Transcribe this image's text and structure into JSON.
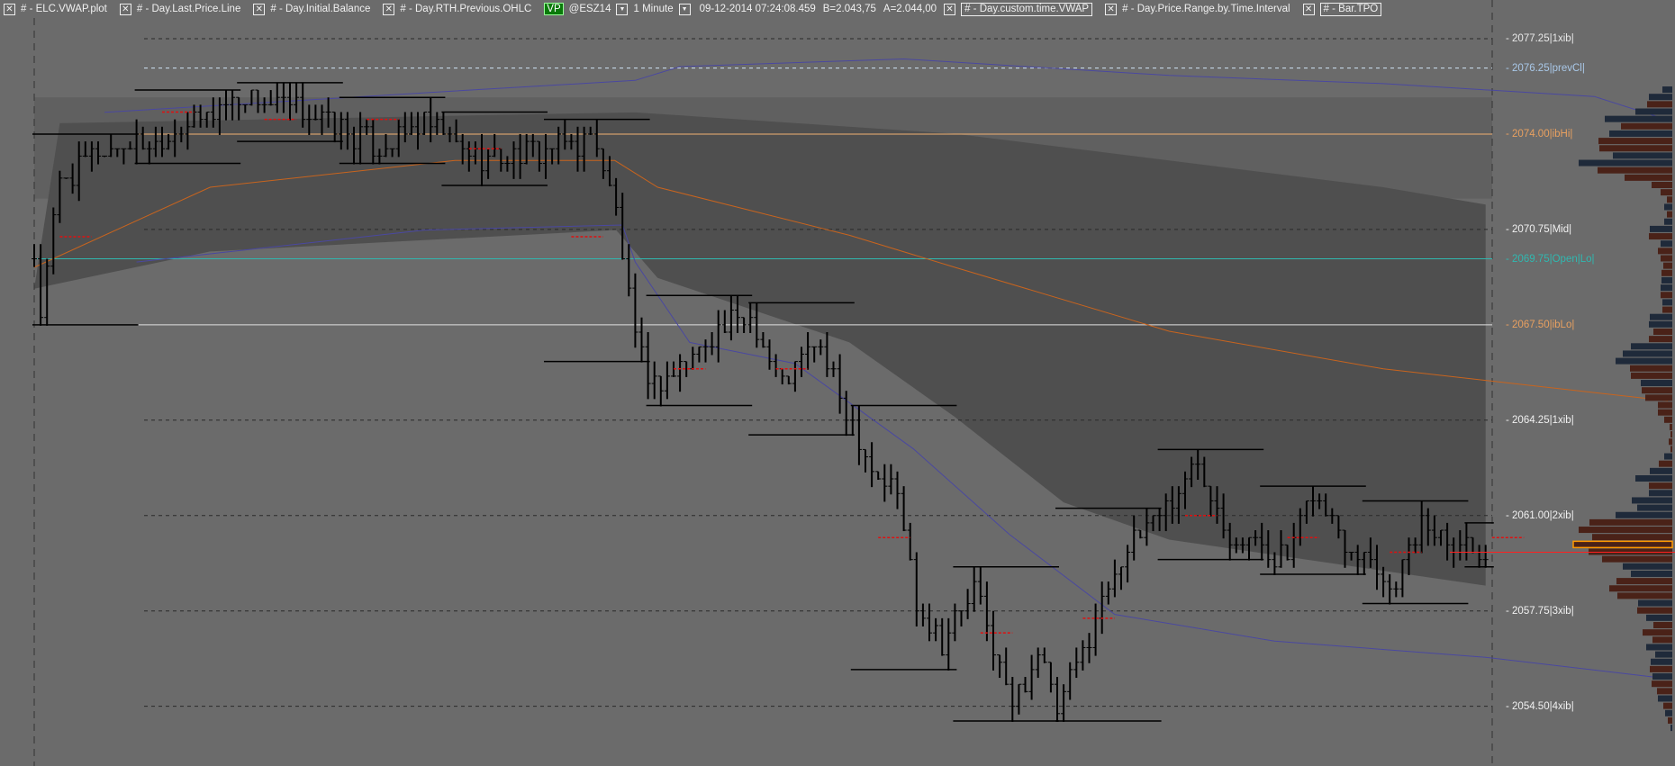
{
  "header": {
    "items": [
      {
        "label": "# - ELC.VWAP.plot",
        "boxed": false
      },
      {
        "label": "# - Day.Last.Price.Line",
        "boxed": false
      },
      {
        "label": "# - Day.Initial.Balance",
        "boxed": false
      },
      {
        "label": "# - Day.RTH.Previous.OHLC",
        "boxed": false
      }
    ],
    "vp_badge": "VP",
    "symbol": "@ESZ14",
    "interval": "1 Minute",
    "datetime": "09-12-2014  07:24:08.459",
    "bid": "B=2.043,75",
    "ask": "A=2.044,00",
    "items2": [
      {
        "label": "# - Day.custom.time.VWAP",
        "boxed": true
      },
      {
        "label": "# - Day.Price.Range.by.Time.Interval",
        "boxed": false
      },
      {
        "label": "# - Bar.TPO",
        "boxed": true
      }
    ],
    "close_icon": "x-box-icon",
    "dropdown_icon": "chevron-down-icon"
  },
  "chart_data": {
    "type": "ohlc",
    "symbol": "@ESZ14",
    "tick_size": 0.25,
    "yrange": [
      2053.5,
      2078.5
    ],
    "levels": [
      {
        "price": "2077.25",
        "tag": "|1xib|",
        "color": "#e8e8e8",
        "line": "#2a2a2a",
        "style": "dash"
      },
      {
        "price": "2076.25",
        "tag": "|prevCl|",
        "color": "#a9c8e8",
        "line": "#cfe4f5",
        "style": "dash"
      },
      {
        "price": "2074.00",
        "tag": "|ibHi|",
        "color": "#e8a060",
        "line": "#f0b070",
        "style": "solid"
      },
      {
        "price": "2070.75",
        "tag": "|Mid|",
        "color": "#f0f0f0",
        "line": "#2a2a2a",
        "style": "dash"
      },
      {
        "price": "2069.75",
        "tag": "|Open|Lo|",
        "color": "#30b8b0",
        "line": "#30b8b0",
        "style": "solid"
      },
      {
        "price": "2067.50",
        "tag": "|ibLo|",
        "color": "#e8a060",
        "line": "#e0e0e0",
        "style": "solid"
      },
      {
        "price": "2064.25",
        "tag": "|1xib|",
        "color": "#f0f0f0",
        "line": "#2a2a2a",
        "style": "dash"
      },
      {
        "price": "2061.00",
        "tag": "|2xib|",
        "color": "#f0f0f0",
        "line": "#2a2a2a",
        "style": "dash"
      },
      {
        "price": "2057.75",
        "tag": "|3xib|",
        "color": "#f0f0f0",
        "line": "#2a2a2a",
        "style": "dash"
      },
      {
        "price": "2054.50",
        "tag": "|4xib|",
        "color": "#f0f0f0",
        "line": "#2a2a2a",
        "style": "dash"
      }
    ],
    "last_price": 2059.75,
    "bar_count": 228,
    "price_path": [
      [
        0,
        2069.8
      ],
      [
        1,
        2067.8
      ],
      [
        4,
        2072.4
      ],
      [
        11,
        2073.5
      ],
      [
        19,
        2073.8
      ],
      [
        33,
        2075.3
      ],
      [
        44,
        2074.6
      ],
      [
        54,
        2073.5
      ],
      [
        61,
        2074.4
      ],
      [
        69,
        2073.2
      ],
      [
        81,
        2073.5
      ],
      [
        88,
        2073.8
      ],
      [
        91,
        2071.3
      ],
      [
        94,
        2066.9
      ],
      [
        97,
        2065.4
      ],
      [
        102,
        2066.2
      ],
      [
        107,
        2067.3
      ],
      [
        112,
        2067.8
      ],
      [
        117,
        2065.4
      ],
      [
        122,
        2066.9
      ],
      [
        127,
        2064.7
      ],
      [
        131,
        2062.6
      ],
      [
        135,
        2061.8
      ],
      [
        138,
        2058.2
      ],
      [
        142,
        2056.7
      ],
      [
        147,
        2058.5
      ],
      [
        153,
        2054.5
      ],
      [
        157,
        2056.4
      ],
      [
        160,
        2054.2
      ],
      [
        164,
        2056.4
      ],
      [
        169,
        2059.3
      ],
      [
        174,
        2060.7
      ],
      [
        179,
        2061.8
      ],
      [
        182,
        2062.9
      ],
      [
        187,
        2060.4
      ],
      [
        196,
        2059.6
      ],
      [
        200,
        2061.8
      ],
      [
        204,
        2060.4
      ],
      [
        209,
        2059.6
      ],
      [
        212,
        2058.5
      ],
      [
        217,
        2060.7
      ],
      [
        227,
        2059.8
      ]
    ],
    "vwap": [
      [
        0,
        2069.46
      ],
      [
        27.5,
        2072.19
      ],
      [
        65.8,
        2073.1
      ],
      [
        90.8,
        2073.1
      ],
      [
        97.5,
        2072.19
      ],
      [
        127.5,
        2070.55
      ],
      [
        144,
        2069.46
      ],
      [
        177.5,
        2067.28
      ],
      [
        211,
        2066.0
      ],
      [
        255.5,
        2064.91
      ]
    ],
    "upper_band": [
      [
        11,
        2074.74
      ],
      [
        66,
        2075.47
      ],
      [
        94,
        2075.83
      ],
      [
        101,
        2076.3
      ],
      [
        136,
        2076.56
      ],
      [
        177.5,
        2076.0
      ],
      [
        211,
        2075.72
      ],
      [
        244,
        2075.28
      ],
      [
        255.5,
        2074.48
      ]
    ],
    "lower_band": [
      [
        16,
        2069.64
      ],
      [
        61,
        2070.73
      ],
      [
        92,
        2070.9
      ],
      [
        94,
        2069.64
      ],
      [
        102.5,
        2066.9
      ],
      [
        119,
        2066.18
      ],
      [
        137.5,
        2063.27
      ],
      [
        152.5,
        2060.36
      ],
      [
        169,
        2057.63
      ],
      [
        194,
        2056.72
      ],
      [
        227,
        2056.17
      ],
      [
        255.5,
        2055.44
      ]
    ],
    "shade_top": [
      [
        4,
        2074.37
      ],
      [
        94,
        2074.74
      ],
      [
        144,
        2074.01
      ],
      [
        177.5,
        2073.1
      ],
      [
        211,
        2072.19
      ],
      [
        227,
        2071.6
      ]
    ],
    "shade_bottom": [
      [
        0,
        2068.73
      ],
      [
        27.5,
        2070.0
      ],
      [
        91,
        2070.73
      ],
      [
        97.5,
        2069.1
      ],
      [
        127.5,
        2066.9
      ],
      [
        144,
        2064.36
      ],
      [
        161,
        2061.45
      ],
      [
        177.5,
        2060.18
      ],
      [
        227,
        2058.61
      ]
    ],
    "range_interval_bars": 16,
    "profile": {
      "top_price": 2075.5,
      "poc_price": 2060.0,
      "volumes": [
        11,
        26,
        28,
        41,
        75,
        57,
        70,
        82,
        81,
        66,
        104,
        83,
        53,
        23,
        13,
        6,
        9,
        6,
        9,
        25,
        26,
        13,
        16,
        13,
        10,
        12,
        12,
        13,
        13,
        11,
        11,
        25,
        26,
        21,
        26,
        46,
        55,
        63,
        47,
        46,
        35,
        34,
        30,
        16,
        16,
        9,
        3,
        2,
        4,
        2,
        9,
        15,
        25,
        41,
        26,
        26,
        45,
        39,
        63,
        92,
        104,
        89,
        110,
        93,
        78,
        55,
        46,
        62,
        70,
        61,
        38,
        39,
        29,
        21,
        33,
        22,
        29,
        19,
        24,
        25,
        22,
        23,
        17,
        16,
        10,
        8,
        5,
        2
      ],
      "sides": "bbrbbrbrrbbrrrrrbrbbrbrrrrbbrbrbbrrbbbrrbrrrrrrrrrbrbbrbbbbrrrrrrbbrrrbrbrrrbbbrbrrbrbr",
      "colors": {
        "b": "#1f2a3a",
        "r": "#4a2218",
        "poc_outline": "#ff9900"
      }
    },
    "colors": {
      "bars": "#000000",
      "vwap": "#c8641e",
      "band": "#4a48a0",
      "shade": "#4f4f4f",
      "ib_box": "#606060",
      "last": "#ff2020",
      "background": "#6b6b6b"
    }
  }
}
